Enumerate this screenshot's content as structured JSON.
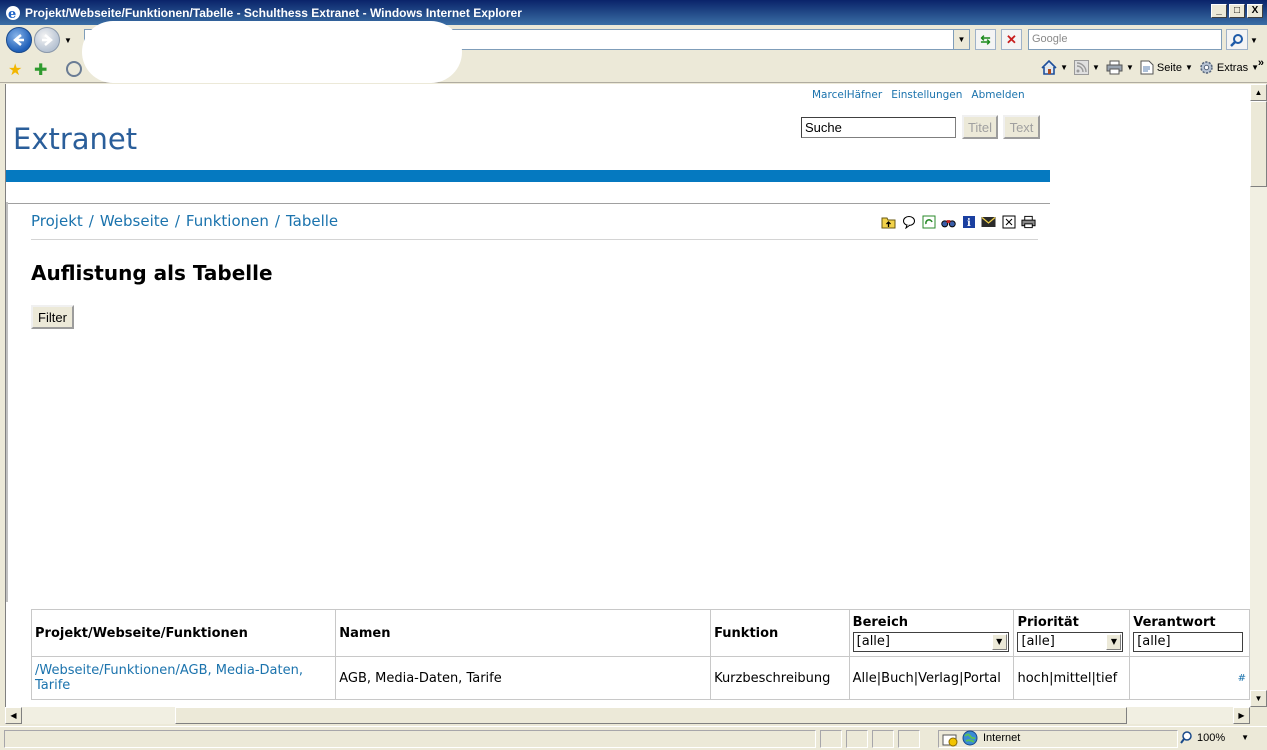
{
  "window": {
    "title": "Projekt/Webseite/Funktionen/Tabelle - Schulthess Extranet - Windows Internet Explorer",
    "controls": [
      "_",
      "□",
      "X"
    ]
  },
  "browser": {
    "search_placeholder": "Google",
    "commands": [
      "Seite",
      "Extras"
    ]
  },
  "page": {
    "user_links": [
      "MarcelHäfner",
      "Einstellungen",
      "Abmelden"
    ],
    "brand": "Extranet",
    "search_value": "Suche",
    "search_buttons": [
      "Titel",
      "Text"
    ],
    "breadcrumb": [
      "Projekt",
      "/",
      "Webseite",
      "/",
      "Funktionen",
      "/",
      "Tabelle"
    ],
    "heading": "Auflistung als Tabelle",
    "filter_button": "Filter",
    "table": {
      "headers": [
        "Projekt/Webseite/Funktionen",
        "Namen",
        "Funktion",
        "Bereich",
        "Priorität",
        "Verantwort"
      ],
      "filters": [
        "[alle]",
        "[alle]",
        "[alle]"
      ],
      "rows": [
        {
          "path": "/Webseite/Funktionen/AGB, Media-Daten, Tarife",
          "namen": "AGB, Media-Daten, Tarife",
          "funktion": "Kurzbeschreibung",
          "bereich": "Alle|Buch|Verlag|Portal",
          "prioritaet": "hoch|mittel|tief",
          "verantwort": "#"
        }
      ]
    }
  },
  "status": {
    "zone": "Internet",
    "zoom": "100%"
  }
}
